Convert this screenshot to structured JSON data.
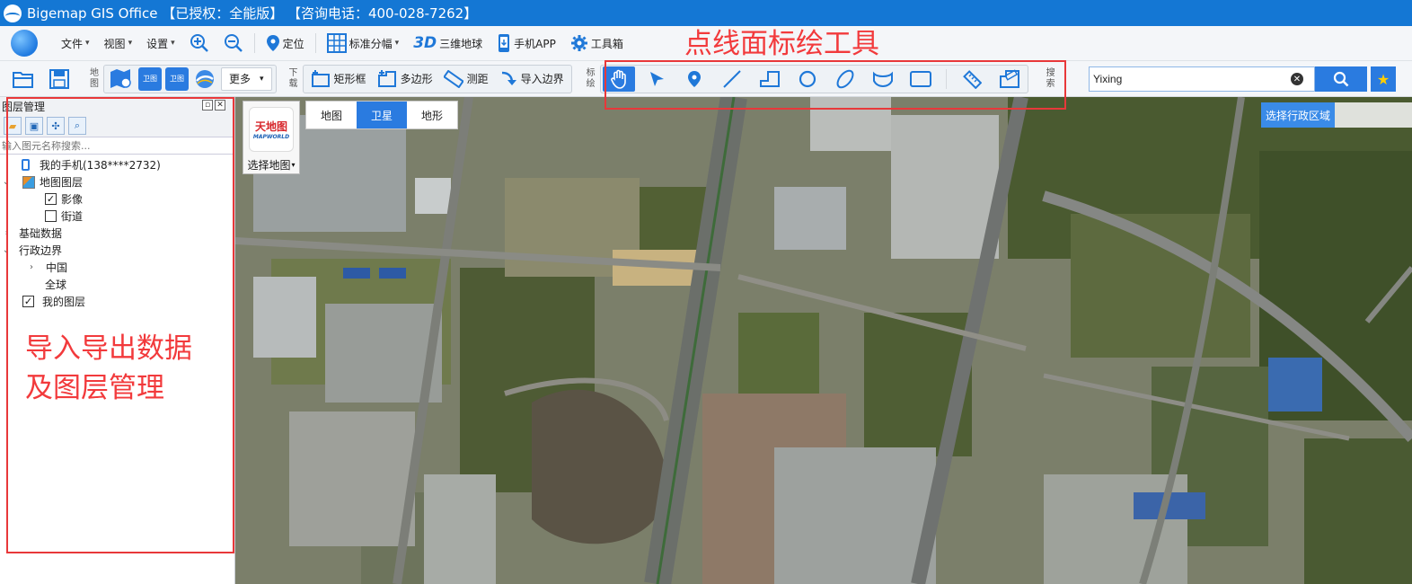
{
  "window": {
    "title": "Bigemap GIS Office 【已授权：全能版】 【咨询电话：400-028-7262】"
  },
  "menu": {
    "items": [
      {
        "label": "文件",
        "icon": "file-menu"
      },
      {
        "label": "视图",
        "icon": "view-menu"
      },
      {
        "label": "设置",
        "icon": "settings-menu"
      }
    ],
    "zoom_in_icon": "zoom-in-icon",
    "zoom_out_icon": "zoom-out-icon",
    "locate": "定位",
    "standard_sheet": "标准分幅",
    "three_d_prefix": "3D",
    "three_d": "三维地球",
    "mobile_app": "手机APP",
    "toolbox": "工具箱"
  },
  "toolbar": {
    "map_label": "地图",
    "download_label": "下载",
    "draw_label": "标绘",
    "search_label": "搜索",
    "sq1_text": "卫图",
    "sq2_text": "卫图",
    "more": "更多",
    "rect_frame": "矩形框",
    "polygon": "多边形",
    "measure": "测距",
    "import_boundary": "导入边界"
  },
  "draw_tools": [
    "pan-hand-icon",
    "select-arrow-icon",
    "marker-icon",
    "line-icon",
    "polyline-icon",
    "circle-icon",
    "ellipse-icon",
    "curve-icon",
    "rectangle-icon",
    "ruler-icon",
    "area-measure-icon"
  ],
  "search": {
    "value": "Yixing"
  },
  "layer_panel": {
    "title": "图层管理",
    "search_placeholder": "输入图元名称搜索...",
    "tree": [
      {
        "label": "我的手机(138****2732)"
      },
      {
        "label": "地图图层"
      },
      {
        "label": "影像",
        "checked": true
      },
      {
        "label": "街道",
        "checked": false
      },
      {
        "label": "基础数据"
      },
      {
        "label": "行政边界"
      },
      {
        "label": "中国"
      },
      {
        "label": "全球"
      },
      {
        "label": "我的图层",
        "checked": true
      }
    ]
  },
  "map": {
    "card_title_cn": "天地图",
    "card_title_en": "MAPWORLD",
    "select_map": "选择地图",
    "tabs": [
      {
        "label": "地图",
        "active": false
      },
      {
        "label": "卫星",
        "active": true
      },
      {
        "label": "地形",
        "active": false
      }
    ],
    "select_region": "选择行政区域"
  },
  "annotations": {
    "draw_tools_note": "点线面标绘工具",
    "layers_note_line1": "导入导出数据",
    "layers_note_line2": "及图层管理"
  },
  "colors": {
    "title_bar": "#1477d4",
    "accent": "#2a7be0",
    "annotation_red": "#e8383a"
  }
}
